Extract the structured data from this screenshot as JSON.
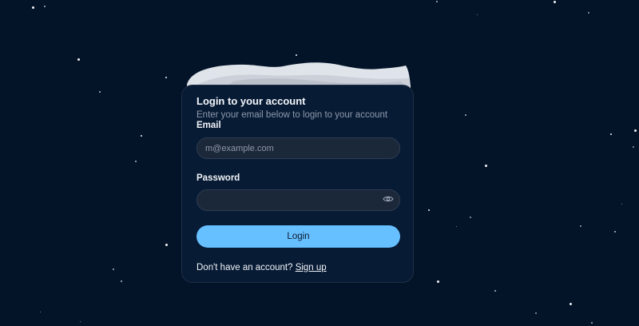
{
  "background": {
    "color": "#031429"
  },
  "login": {
    "title": "Login to your account",
    "subtitle": "Enter your email below to login to your account",
    "email_label": "Email",
    "email_placeholder": "m@example.com",
    "email_value": "",
    "password_label": "Password",
    "password_value": "",
    "show_password_icon": "eye-icon",
    "login_button": "Login",
    "signup_prompt": "Don't have an account?",
    "signup_link": "Sign up",
    "accent_color": "#66bfff"
  }
}
